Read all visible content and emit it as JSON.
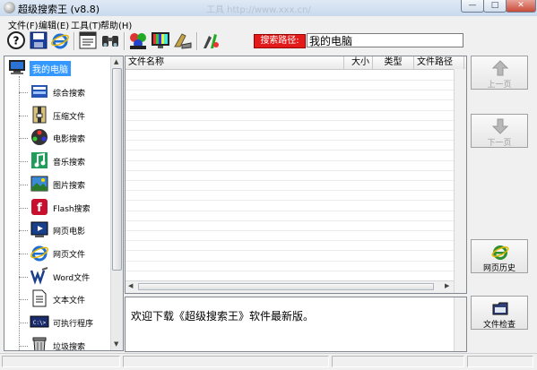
{
  "window": {
    "title": "超级搜索王 (v8.8)",
    "ghost_text": "工具 http://www.xxx.cn/"
  },
  "menu": [
    "文件(F)",
    "编辑(E)",
    "工具(T)",
    "帮助(H)"
  ],
  "toolbar": {
    "icons": [
      "help-icon",
      "save-icon",
      "ie-icon",
      "properties-icon",
      "binoculars-icon",
      "multimedia-icon",
      "monitor-icon",
      "settings-icon",
      "tools-icon"
    ],
    "search_path_label": "搜索路径:",
    "search_path_value": "我的电脑"
  },
  "tree": {
    "root": "我的电脑",
    "items": [
      {
        "label": "综合搜索",
        "icon": "multi-search-icon"
      },
      {
        "label": "压缩文件",
        "icon": "archive-icon"
      },
      {
        "label": "电影搜索",
        "icon": "film-icon"
      },
      {
        "label": "音乐搜索",
        "icon": "music-icon"
      },
      {
        "label": "图片搜索",
        "icon": "picture-icon"
      },
      {
        "label": "Flash搜索",
        "icon": "flash-icon"
      },
      {
        "label": "网页电影",
        "icon": "web-movie-icon"
      },
      {
        "label": "网页文件",
        "icon": "ie-icon"
      },
      {
        "label": "Word文件",
        "icon": "word-icon"
      },
      {
        "label": "文本文件",
        "icon": "text-file-icon"
      },
      {
        "label": "可执行程序",
        "icon": "exe-icon"
      },
      {
        "label": "垃圾搜索",
        "icon": "trash-icon"
      }
    ]
  },
  "list": {
    "columns": [
      "文件名称",
      "大小",
      "类型",
      "文件路径"
    ]
  },
  "message": "欢迎下载《超级搜索王》软件最新版。",
  "right_buttons": [
    {
      "label": "上一页",
      "icon": "up-arrow-icon",
      "enabled": false
    },
    {
      "label": "下一页",
      "icon": "down-arrow-icon",
      "enabled": false
    },
    {
      "label": "网页历史",
      "icon": "ie-icon",
      "enabled": true
    },
    {
      "label": "文件检查",
      "icon": "folder-check-icon",
      "enabled": true
    }
  ],
  "colors": {
    "search_label_bg": "#e31a1a",
    "selection": "#3399ff"
  }
}
